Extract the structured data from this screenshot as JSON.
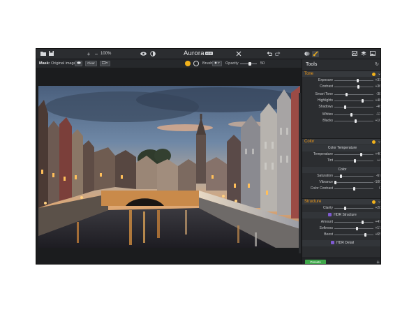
{
  "app": {
    "name": "Aurora",
    "badge": "HDR"
  },
  "toolbar": {
    "zoom": "100%",
    "zoom_in": "+",
    "zoom_out": "−"
  },
  "mask_bar": {
    "mask_label": "Mask:",
    "mask_value": "Original image",
    "clear_label": "Clear",
    "brush_label": "Brush:",
    "opacity_label": "Opacity",
    "opacity_value": "50",
    "opacity_fraction": 0.5
  },
  "panel": {
    "title": "Tools",
    "presets_label": "Presets",
    "add_label": "+",
    "sections": {
      "tone": "Tone",
      "color": "Color",
      "structure": "Structure"
    },
    "tone": [
      {
        "name": "Exposure",
        "value": "+31",
        "pos": 0.6
      },
      {
        "name": "Contrast",
        "value": "+36",
        "pos": 0.62
      },
      {
        "name": "Smart Tone",
        "value": "-38",
        "pos": 0.31
      },
      {
        "name": "Highlights",
        "value": "+48",
        "pos": 0.74
      },
      {
        "name": "Shadows",
        "value": "-46",
        "pos": 0.27
      },
      {
        "name": "Whites",
        "value": "-13",
        "pos": 0.43
      },
      {
        "name": "Blacks",
        "value": "+10",
        "pos": 0.55
      }
    ],
    "color_temperature_header": "Color Temperature",
    "color_temp": [
      {
        "name": "Temperature",
        "value": "+40",
        "pos": 0.7
      },
      {
        "name": "Tint",
        "value": "+4",
        "pos": 0.52
      }
    ],
    "color_header": "Color",
    "color": [
      {
        "name": "Saturation",
        "value": "-67",
        "pos": 0.16
      },
      {
        "name": "Vibrance",
        "value": "-100",
        "pos": 0.0
      },
      {
        "name": "Color Contrast",
        "value": "0",
        "pos": 0.5
      }
    ],
    "structure": [
      {
        "name": "Clarity",
        "value": "+28",
        "pos": 0.26
      }
    ],
    "hdr_structure_header": "HDR Structure",
    "hdr_structure": [
      {
        "name": "Amount",
        "value": "+47",
        "pos": 0.74
      },
      {
        "name": "Softness",
        "value": "+17",
        "pos": 0.58
      },
      {
        "name": "Boost",
        "value": "+65",
        "pos": 0.82
      }
    ],
    "hdr_detail_header": "HDR Detail"
  },
  "colors": {
    "accent": "#f09a1a",
    "toggle": "#f2b21b",
    "presets": "#3fa84a",
    "hdr_marker": "#7f5ad1"
  }
}
